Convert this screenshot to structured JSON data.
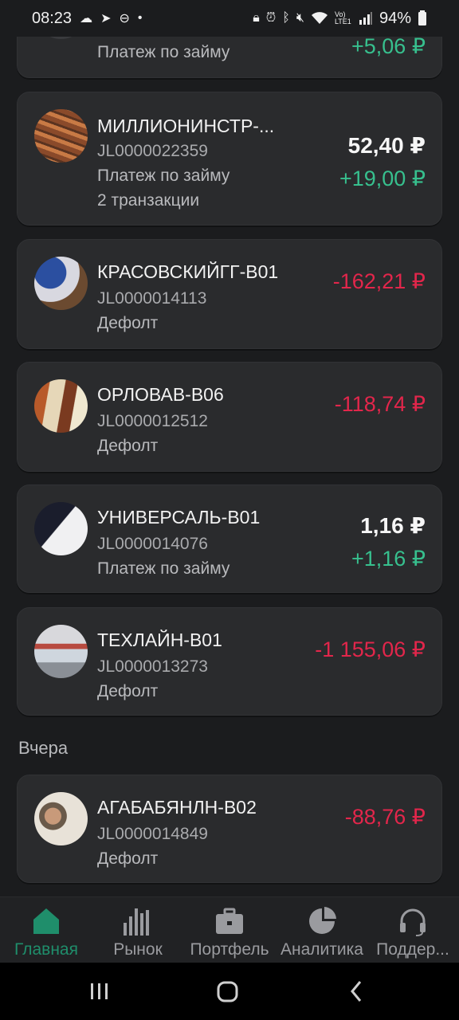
{
  "status": {
    "time": "08:23",
    "battery": "94%",
    "network": "Vo) LTE1"
  },
  "cards": [
    {
      "type": "Платеж по займу",
      "amount_change": "+5,06 ₽"
    },
    {
      "name": "МИЛЛИОНИНСТР-...",
      "code": "JL0000022359",
      "type": "Платеж по займу",
      "extra": "2 транзакции",
      "amount": "52,40 ₽",
      "amount_change": "+19,00 ₽"
    },
    {
      "name": "КРАСОВСКИЙГГ-В01",
      "code": "JL0000014113",
      "type": "Дефолт",
      "amount_change": "-162,21 ₽"
    },
    {
      "name": "ОРЛОВАВ-В06",
      "code": "JL0000012512",
      "type": "Дефолт",
      "amount_change": "-118,74 ₽"
    },
    {
      "name": "УНИВЕРСАЛЬ-В01",
      "code": "JL0000014076",
      "type": "Платеж по займу",
      "amount": "1,16 ₽",
      "amount_change": "+1,16 ₽"
    },
    {
      "name": "ТЕХЛАЙН-В01",
      "code": "JL0000013273",
      "type": "Дефолт",
      "amount_change": "-1 155,06 ₽"
    },
    {
      "name": "АГАБАБЯНЛН-В02",
      "code": "JL0000014849",
      "type": "Дефолт",
      "amount_change": "-88,76 ₽"
    }
  ],
  "section": {
    "yesterday": "Вчера"
  },
  "tabs": [
    {
      "label": "Главная",
      "icon": "home-icon",
      "active": true
    },
    {
      "label": "Рынок",
      "icon": "bar-chart-icon"
    },
    {
      "label": "Портфель",
      "icon": "briefcase-icon"
    },
    {
      "label": "Аналитика",
      "icon": "pie-chart-icon"
    },
    {
      "label": "Поддер...",
      "icon": "headset-icon"
    }
  ],
  "colors": {
    "positive": "#37c08e",
    "negative": "#e2264b",
    "accent": "#1f8e6b",
    "card": "#2a2b2d",
    "background": "#1b1c1e"
  }
}
